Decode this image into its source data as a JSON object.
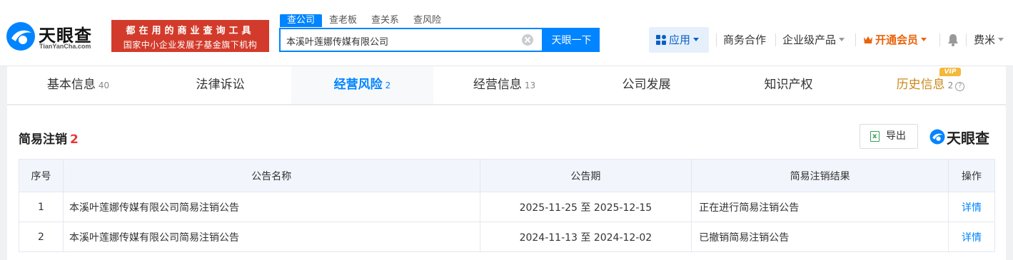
{
  "header": {
    "logo_text": "天眼查",
    "logo_sub": "TianYanCha.com",
    "banner_line1": "都在用的商业查询工具",
    "banner_line2": "国家中小企业发展子基金旗下机构",
    "search_tabs": [
      "查公司",
      "查老板",
      "查关系",
      "查风险"
    ],
    "search_value": "本溪叶莲娜传媒有限公司",
    "search_button": "天眼一下",
    "nav": {
      "app": "应用",
      "business": "商务合作",
      "enterprise": "企业级产品",
      "vip": "开通会员",
      "user": "费米"
    }
  },
  "tabs": [
    {
      "label": "基本信息",
      "count": "40"
    },
    {
      "label": "法律诉讼",
      "count": ""
    },
    {
      "label": "经营风险",
      "count": "2"
    },
    {
      "label": "经营信息",
      "count": "13"
    },
    {
      "label": "公司发展",
      "count": ""
    },
    {
      "label": "知识产权",
      "count": ""
    },
    {
      "label": "历史信息",
      "count": "2"
    }
  ],
  "vip_badge": "VIP",
  "section": {
    "title": "简易注销",
    "count": "2",
    "export_label": "导出",
    "watermark": "天眼查"
  },
  "table": {
    "headers": [
      "序号",
      "公告名称",
      "公告期",
      "简易注销结果",
      "操作"
    ],
    "rows": [
      [
        "1",
        "本溪叶莲娜传媒有限公司简易注销公告",
        "2025-11-25 至 2025-12-15",
        "正在进行简易注销公告",
        "详情"
      ],
      [
        "2",
        "本溪叶莲娜传媒有限公司简易注销公告",
        "2024-11-13 至 2024-12-02",
        "已撤销简易注销公告",
        "详情"
      ]
    ]
  },
  "colors": {
    "brand_blue": "#0084ff",
    "banner_red": "#d23b2b",
    "vip_orange": "#e9630b",
    "count_red": "#e5393a"
  }
}
